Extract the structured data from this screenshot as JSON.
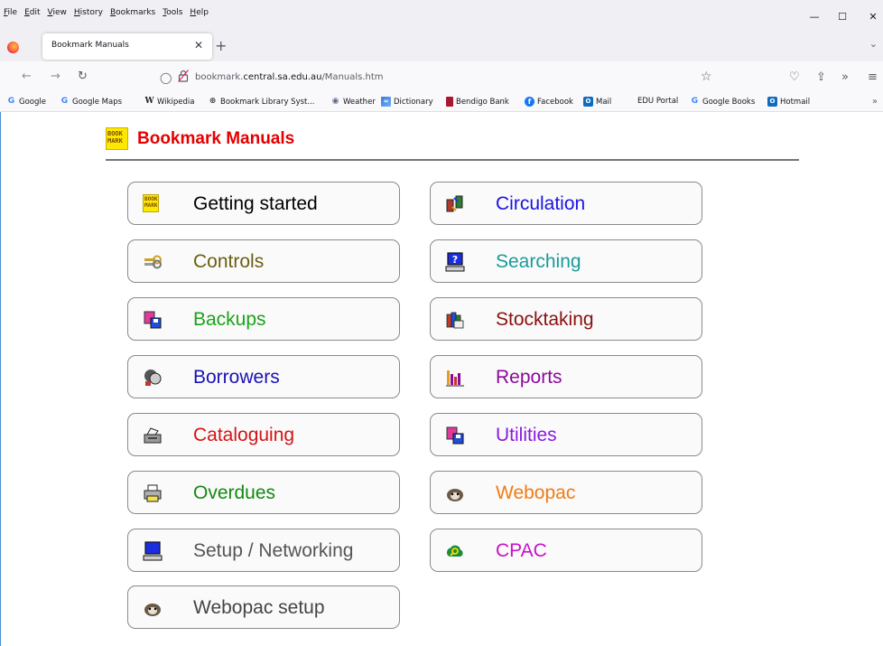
{
  "menu": [
    "File",
    "Edit",
    "View",
    "History",
    "Bookmarks",
    "Tools",
    "Help"
  ],
  "window_controls": {
    "minimize": "—",
    "maximize": "☐",
    "close": "✕"
  },
  "tab": {
    "title": "Bookmark Manuals",
    "close": "✕",
    "new_tab": "+",
    "list": "⌄"
  },
  "nav": {
    "back": "←",
    "forward": "→",
    "reload": "↻"
  },
  "url": {
    "domain_prefix": "bookmark.",
    "domain": "central.sa.edu.au",
    "path": "/Manuals.htm"
  },
  "toolbar_icons": [
    "pocket-icon",
    "share-icon",
    "overflow-icon",
    "menu-icon"
  ],
  "bookmarks": [
    {
      "label": "Google",
      "icon": "G"
    },
    {
      "label": "Google Maps",
      "icon": "G"
    },
    {
      "label": "Wikipedia",
      "icon": "W"
    },
    {
      "label": "Bookmark Library Syst...",
      "icon": "⊕"
    },
    {
      "label": "Weather",
      "icon": "◉"
    },
    {
      "label": "Dictionary",
      "icon": "≈"
    },
    {
      "label": "Bendigo Bank",
      "icon": ""
    },
    {
      "label": "Facebook",
      "icon": "f"
    },
    {
      "label": "Mail",
      "icon": "O"
    },
    {
      "label": "EDU Portal",
      "icon": ""
    },
    {
      "label": "Google Books",
      "icon": "G"
    },
    {
      "label": "Hotmail",
      "icon": "O"
    }
  ],
  "bookmarks_chevron": "»",
  "page": {
    "logo_text": "BOOK MARK",
    "title": "Bookmark Manuals"
  },
  "manuals": [
    {
      "label": "Getting started",
      "color": "#000000",
      "icon": "book-icon"
    },
    {
      "label": "Circulation",
      "color": "#1a12e6",
      "icon": "circulation-icon"
    },
    {
      "label": "Controls",
      "color": "#6b5e12",
      "icon": "keys-icon"
    },
    {
      "label": "Searching",
      "color": "#1a9a9a",
      "icon": "search-computer-icon"
    },
    {
      "label": "Backups",
      "color": "#19a319",
      "icon": "backup-icon"
    },
    {
      "label": "Stocktaking",
      "color": "#8b0f0f",
      "icon": "stocktaking-icon"
    },
    {
      "label": "Borrowers",
      "color": "#1a12b3",
      "icon": "borrowers-icon"
    },
    {
      "label": "Reports",
      "color": "#8a0a9a",
      "icon": "reports-icon"
    },
    {
      "label": "Cataloguing",
      "color": "#d41414",
      "icon": "cataloguing-icon"
    },
    {
      "label": "Utilities",
      "color": "#8a1ae0",
      "icon": "utilities-icon"
    },
    {
      "label": "Overdues",
      "color": "#128a12",
      "icon": "printer-icon"
    },
    {
      "label": "Webopac",
      "color": "#f07c12",
      "icon": "ferret-icon"
    },
    {
      "label": "Setup / Networking",
      "color": "#555555",
      "icon": "computer-icon"
    },
    {
      "label": "CPAC",
      "color": "#c812c8",
      "icon": "cloud-search-icon"
    },
    {
      "label": "Webopac setup",
      "color": "#444444",
      "icon": "ferret-icon"
    }
  ]
}
